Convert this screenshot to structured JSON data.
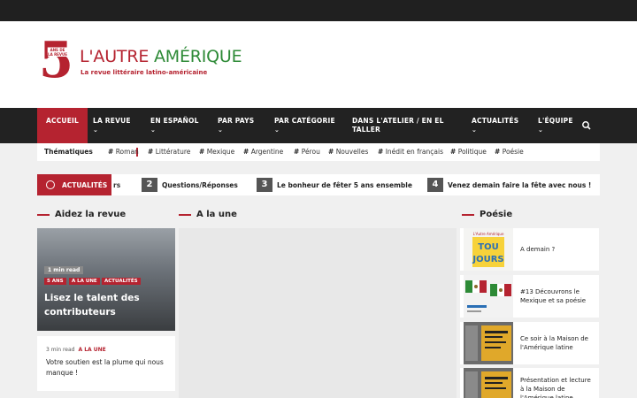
{
  "header": {
    "logo_number": "5",
    "logo_badge": "ANS DE LA REVUE",
    "logo_title_part1": "L'AUTRE ",
    "logo_title_part2": "AMÉRIQUE",
    "logo_tagline": "La revue littéraire latino-américaine"
  },
  "nav": {
    "items": [
      {
        "label": "ACCUEIL",
        "chevron": ""
      },
      {
        "label": "LA REVUE",
        "chevron": "⌄"
      },
      {
        "label": "EN ESPAÑOL",
        "chevron": "⌄"
      },
      {
        "label": "PAR PAYS",
        "chevron": "⌄"
      },
      {
        "label": "PAR CATÉGORIE",
        "chevron": "⌄"
      },
      {
        "label": "DANS L'ATELIER / EN EL TALLER",
        "chevron": ""
      },
      {
        "label": "ACTUALITÉS",
        "chevron": "⌄"
      },
      {
        "label": "L'ÉQUIPE",
        "chevron": "⌄"
      }
    ]
  },
  "thematiques": {
    "label": "Thématiques",
    "tags": [
      "Roman",
      "Littérature",
      "Mexique",
      "Argentine",
      "Pérou",
      "Nouvelles",
      "Inédit en français",
      "Politique",
      "Poésie"
    ]
  },
  "ticker": {
    "label": "ACTUALITÉS",
    "fragment": "rs",
    "items": [
      {
        "num": "2",
        "text": "Questions/Réponses"
      },
      {
        "num": "3",
        "text": "Le bonheur de fêter 5 ans ensemble"
      },
      {
        "num": "4",
        "text": "Venez demain faire la fête avec nous !"
      }
    ]
  },
  "sections": {
    "left": "Aidez la revue",
    "center": "A la une",
    "right": "Poésie"
  },
  "card_feature": {
    "read_time": "1 min read",
    "categories": [
      "5 ANS",
      "A LA UNE",
      "ACTUALITÉS"
    ],
    "title": "Lisez le talent des contributeurs"
  },
  "card_small": {
    "read_time": "3 min read",
    "category": "A LA UNE",
    "title": "Votre soutien est la plume qui nous manque !"
  },
  "poesie": [
    {
      "title": "A demain ?",
      "thumb_text": "TOUJOURS"
    },
    {
      "title": "#13 Découvrons le Mexique et sa poésie",
      "thumb_text": ""
    },
    {
      "title": "Ce soir à la Maison de l'Amérique latine",
      "thumb_text": ""
    },
    {
      "title": "Présentation et lecture à la Maison de l'Amérique latine",
      "thumb_text": ""
    }
  ],
  "colors": {
    "accent": "#b52330",
    "green": "#2d8a36",
    "nav_bg": "#222222"
  }
}
